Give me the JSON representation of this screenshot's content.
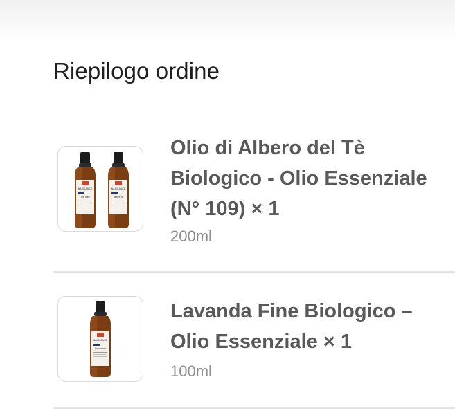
{
  "order_summary": {
    "title": "Riepilogo ordine",
    "items": [
      {
        "name": "Olio di Albero del Tè Biologico - Olio Essenziale (N° 109)",
        "quantity_text": "× 1",
        "variant": "200ml",
        "bottle_label_brand": "NAISSANCE",
        "bottle_label_product": "Tea Tree",
        "image_icon": "two-amber-bottles-image"
      },
      {
        "name": "Lavanda Fine Biologico – Olio Essenziale ",
        "quantity_text": "× 1",
        "variant": "100ml",
        "bottle_label_brand": "NAISSANCE",
        "bottle_label_product": "Lavender",
        "image_icon": "amber-bottle-image"
      }
    ]
  },
  "colors": {
    "title": "#1f1f1f",
    "item_name": "#595959",
    "variant": "#8d8d8d",
    "divider": "#e4e4e4",
    "bottle_amber": "#7a3e12",
    "bottle_cap": "#1c1c1c"
  }
}
